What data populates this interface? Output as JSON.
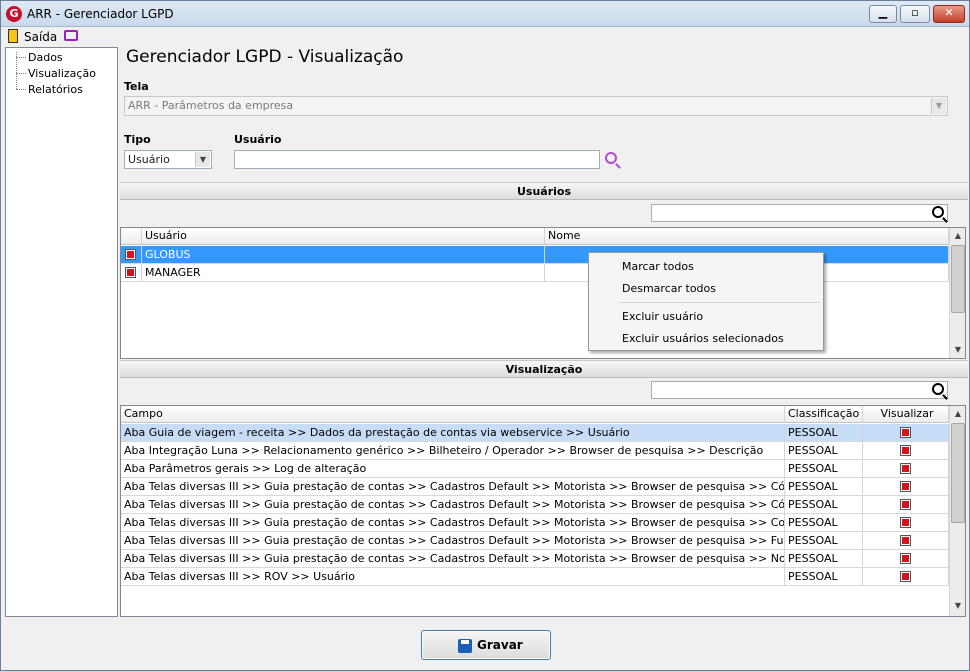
{
  "window": {
    "title": "ARR - Gerenciador LGPD",
    "app_icon": "G"
  },
  "menubar": {
    "exit_label": "Saída"
  },
  "sidebar": {
    "items": [
      {
        "label": "Dados"
      },
      {
        "label": "Visualização"
      },
      {
        "label": "Relatórios"
      }
    ]
  },
  "page_title": "Gerenciador LGPD - Visualização",
  "tela": {
    "label": "Tela",
    "value": "ARR - Parâmetros da empresa"
  },
  "tipo": {
    "label": "Tipo",
    "value": "Usuário"
  },
  "usuario": {
    "label": "Usuário",
    "value": ""
  },
  "users_section": {
    "title": "Usuários",
    "search_value": "",
    "columns": [
      "Usuário",
      "Nome"
    ],
    "rows": [
      {
        "checked": true,
        "usuario": "GLOBUS",
        "nome": "",
        "selected": true
      },
      {
        "checked": true,
        "usuario": "MANAGER",
        "nome": "",
        "selected": false
      }
    ]
  },
  "context_menu": {
    "items": [
      "Marcar todos",
      "Desmarcar todos",
      "Excluir usuário",
      "Excluir usuários selecionados"
    ]
  },
  "view_section": {
    "title": "Visualização",
    "search_value": "",
    "columns": [
      "Campo",
      "Classificação",
      "Visualizar"
    ],
    "rows": [
      {
        "campo": "Aba Guia de viagem - receita >> Dados da prestação de contas via webservice >> Usuário",
        "classificacao": "PESSOAL",
        "visualizar": true
      },
      {
        "campo": "Aba Integração Luna >> Relacionamento genérico >> Bilheteiro / Operador >> Browser de pesquisa >> Descrição",
        "classificacao": "PESSOAL",
        "visualizar": true
      },
      {
        "campo": "Aba Parâmetros gerais >> Log de alteração",
        "classificacao": "PESSOAL",
        "visualizar": true
      },
      {
        "campo": "Aba Telas diversas III >> Guia prestação de contas >> Cadastros Default >> Motorista >> Browser de pesquisa >> Código",
        "classificacao": "PESSOAL",
        "visualizar": true
      },
      {
        "campo": "Aba Telas diversas III >> Guia prestação de contas >> Cadastros Default >> Motorista >> Browser de pesquisa >> Código Interno",
        "classificacao": "PESSOAL",
        "visualizar": true
      },
      {
        "campo": "Aba Telas diversas III >> Guia prestação de contas >> Cadastros Default >> Motorista >> Browser de pesquisa >> Condição",
        "classificacao": "PESSOAL",
        "visualizar": true
      },
      {
        "campo": "Aba Telas diversas III >> Guia prestação de contas >> Cadastros Default >> Motorista >> Browser de pesquisa >> Função",
        "classificacao": "PESSOAL",
        "visualizar": true
      },
      {
        "campo": "Aba Telas diversas III >> Guia prestação de contas >> Cadastros Default >> Motorista >> Browser de pesquisa >> Nome",
        "classificacao": "PESSOAL",
        "visualizar": true
      },
      {
        "campo": "Aba Telas diversas III >> ROV >> Usuário",
        "classificacao": "PESSOAL",
        "visualizar": true
      }
    ]
  },
  "save_button": {
    "label": "Gravar"
  }
}
